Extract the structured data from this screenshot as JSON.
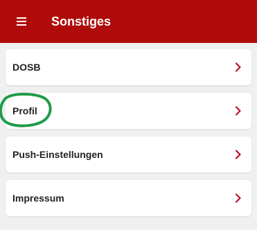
{
  "app_bar": {
    "title": "Sonstiges",
    "menu_icon": "hamburger-menu-icon"
  },
  "colors": {
    "app_bar": "#b00b0b",
    "background": "#f0f0f0",
    "chevron": "#c0102a",
    "highlight": "#1f9b4a"
  },
  "items": [
    {
      "label": "DOSB",
      "icon": "chevron-right-icon"
    },
    {
      "label": "Profil",
      "icon": "chevron-right-icon"
    },
    {
      "label": "Push-Einstellungen",
      "icon": "chevron-right-icon"
    },
    {
      "label": "Impressum",
      "icon": "chevron-right-icon"
    }
  ]
}
